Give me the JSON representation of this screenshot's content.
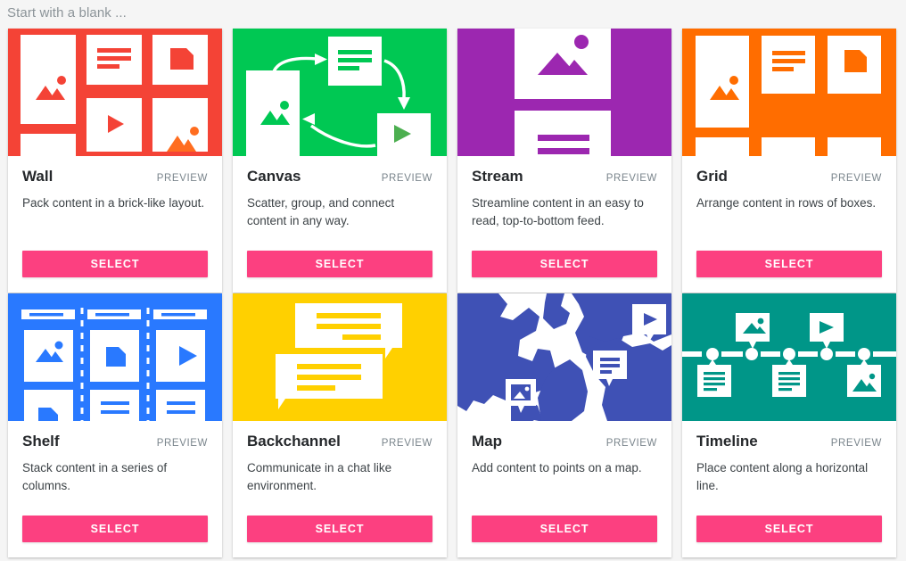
{
  "header": {
    "title": "Start with a blank ..."
  },
  "colors": {
    "select_button": "#fc4080",
    "page_background": "#f5f5f5",
    "card_background": "#ffffff",
    "header_text": "#8c9499"
  },
  "common": {
    "preview_label": "PREVIEW",
    "select_label": "SELECT"
  },
  "cards": [
    {
      "name": "Wall",
      "description": "Pack content in a brick-like layout.",
      "preview_label": "PREVIEW",
      "select_label": "SELECT",
      "thumb_color": "#f44336",
      "thumb_accent_color": "#ff6d1f",
      "thumb_icon": "wall-thumbnail"
    },
    {
      "name": "Canvas",
      "description": "Scatter, group, and connect content in any way.",
      "preview_label": "PREVIEW",
      "select_label": "SELECT",
      "thumb_color": "#00c853",
      "thumb_accent_color": "#43a047",
      "thumb_icon": "canvas-thumbnail"
    },
    {
      "name": "Stream",
      "description": "Streamline content in an easy to read, top-to-bottom feed.",
      "preview_label": "PREVIEW",
      "select_label": "SELECT",
      "thumb_color": "#9c27b0",
      "thumb_accent_color": "#9c27b0",
      "thumb_icon": "stream-thumbnail"
    },
    {
      "name": "Grid",
      "description": "Arrange content in rows of boxes.",
      "preview_label": "PREVIEW",
      "select_label": "SELECT",
      "thumb_color": "#ff6d00",
      "thumb_accent_color": "#ff6d00",
      "thumb_icon": "grid-thumbnail"
    },
    {
      "name": "Shelf",
      "description": "Stack content in a series of columns.",
      "preview_label": "PREVIEW",
      "select_label": "SELECT",
      "thumb_color": "#2979ff",
      "thumb_accent_color": "#2979ff",
      "thumb_icon": "shelf-thumbnail"
    },
    {
      "name": "Backchannel",
      "description": "Communicate in a chat like environment.",
      "preview_label": "PREVIEW",
      "select_label": "SELECT",
      "thumb_color": "#ffd000",
      "thumb_accent_color": "#ffd000",
      "thumb_icon": "backchannel-thumbnail"
    },
    {
      "name": "Map",
      "description": "Add content to points on a map.",
      "preview_label": "PREVIEW",
      "select_label": "SELECT",
      "thumb_color": "#3f51b5",
      "thumb_accent_color": "#3f51b5",
      "thumb_icon": "map-thumbnail"
    },
    {
      "name": "Timeline",
      "description": "Place content along a horizontal line.",
      "preview_label": "PREVIEW",
      "select_label": "SELECT",
      "thumb_color": "#009688",
      "thumb_accent_color": "#009688",
      "thumb_icon": "timeline-thumbnail"
    }
  ]
}
